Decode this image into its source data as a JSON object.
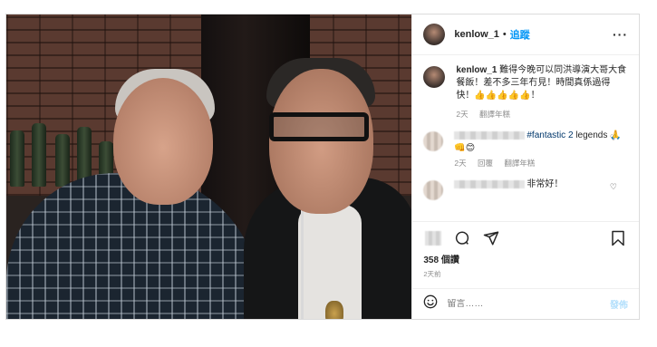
{
  "post": {
    "image_alt": "Selfie of two men in a restaurant",
    "header": {
      "username": "kenlow_1",
      "separator": "•",
      "follow_label": "追蹤",
      "more_icon": "more-horizontal-icon"
    },
    "caption": {
      "username": "kenlow_1",
      "text": "難得今晚可以同洪導演大哥大食餐飯！差不多三年冇見！時間真係過得快！👍👍👍👍👍！",
      "age": "2天",
      "translate": "翻譯年糕"
    },
    "comments": [
      {
        "text_visible": "#fantastic 2 legends 🙏👊😊",
        "hashtag": "#fantastic 2",
        "rest": "legends 🙏👊😊",
        "age": "2天",
        "reply": "回覆",
        "translate": "翻譯年糕"
      },
      {
        "text_visible": "非常好！"
      }
    ],
    "actions": {
      "comment_icon": "comment-icon",
      "share_icon": "share-icon",
      "save_icon": "bookmark-icon"
    },
    "likes": "358 個讚",
    "posted": "2天前",
    "add_comment": {
      "emoji_icon": "emoji-icon",
      "placeholder": "留言……",
      "post_label": "發佈"
    },
    "colors": {
      "link": "#0095f6",
      "text": "#262626",
      "muted": "#8e8e8e",
      "post_disabled": "#b2dffc"
    }
  }
}
